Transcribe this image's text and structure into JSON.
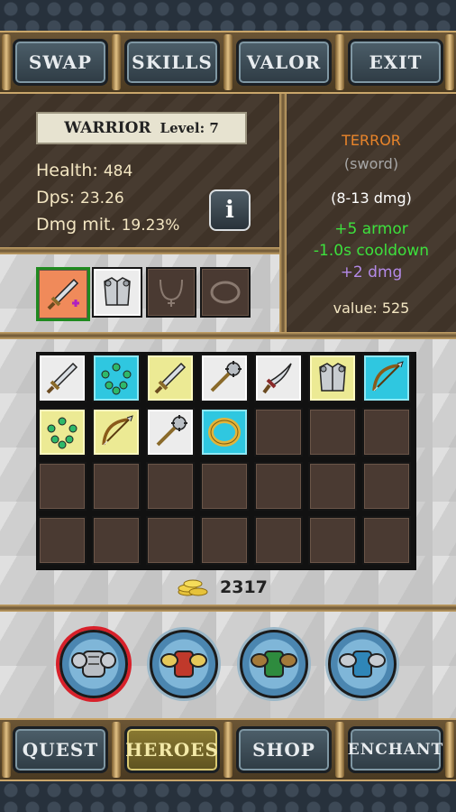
{
  "top_menu": {
    "swap": "SWAP",
    "skills": "SKILLS",
    "valor": "VALOR",
    "exit": "EXIT"
  },
  "hero": {
    "class": "WARRIOR",
    "level_label": "Level: 7",
    "health_label": "Health:",
    "health": "484",
    "dps_label": "Dps:",
    "dps": "23.26",
    "mit_label": "Dmg mit.",
    "mit": "19.23%",
    "info_label": "i"
  },
  "selected_item": {
    "name": "TERROR",
    "type": "(sword)",
    "damage": "(8-13 dmg)",
    "bonus_armor": "+5 armor",
    "bonus_cooldown": "-1.0s cooldown",
    "bonus_dmg": "+2 dmg",
    "value_label": "value:",
    "value": "525",
    "colors": {
      "name": "#e8842a",
      "type": "#a7a7a7",
      "green": "#3de03d",
      "purple": "#b48ae8"
    }
  },
  "equipped": [
    {
      "icon": "sword-icon",
      "rarity": "orange"
    },
    {
      "icon": "armor-icon",
      "rarity": "white"
    },
    {
      "icon": "amulet-slot-icon",
      "rarity": "empty"
    },
    {
      "icon": "ring-slot-icon",
      "rarity": "empty"
    }
  ],
  "inventory": [
    {
      "icon": "sword-icon",
      "rarity": "white"
    },
    {
      "icon": "amulet-icon",
      "rarity": "cyan"
    },
    {
      "icon": "sword-icon",
      "rarity": "yellow"
    },
    {
      "icon": "mace-icon",
      "rarity": "white"
    },
    {
      "icon": "curved-sword-icon",
      "rarity": "white"
    },
    {
      "icon": "armor-icon",
      "rarity": "yellow"
    },
    {
      "icon": "bow-icon",
      "rarity": "cyan"
    },
    {
      "icon": "amulet-icon",
      "rarity": "yellow"
    },
    {
      "icon": "bow-icon",
      "rarity": "yellow"
    },
    {
      "icon": "mace-icon",
      "rarity": "white"
    },
    {
      "icon": "ring-icon",
      "rarity": "cyan"
    }
  ],
  "gold": "2317",
  "heroes": [
    {
      "icon": "warrior-hero-icon",
      "selected": true
    },
    {
      "icon": "red-hero-icon",
      "selected": false
    },
    {
      "icon": "green-hero-icon",
      "selected": false
    },
    {
      "icon": "blue-hero-icon",
      "selected": false
    }
  ],
  "bottom_menu": {
    "quest": "QUEST",
    "heroes": "HEROES",
    "shop": "SHOP",
    "enchant": "ENCHANT"
  }
}
